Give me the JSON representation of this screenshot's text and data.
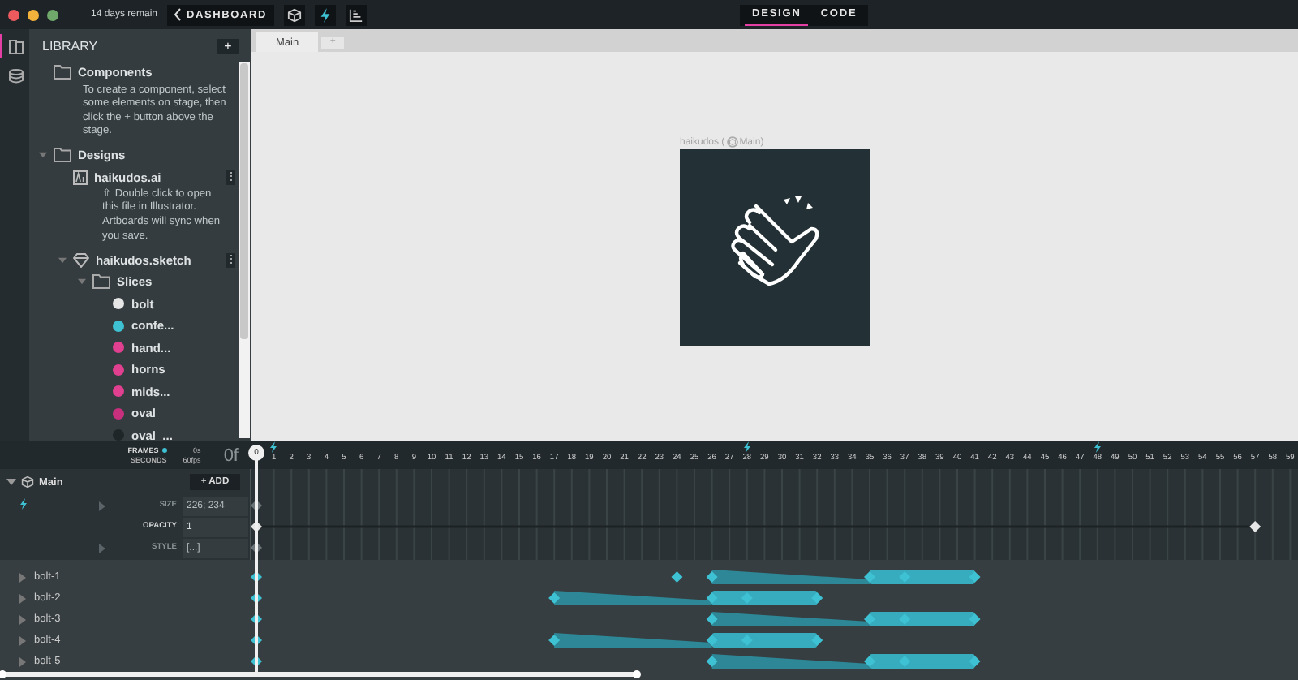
{
  "top_bar": {
    "trial": "14 days remain",
    "dashboard_button": "DASHBOARD",
    "mode_tabs": [
      {
        "label": "DESIGN",
        "selected": true
      },
      {
        "label": "CODE",
        "selected": false
      }
    ]
  },
  "side_strip": [
    {
      "kind": "library",
      "selected": true
    },
    {
      "kind": "states",
      "selected": false
    }
  ],
  "library": {
    "title": "LIBRARY",
    "add": "+",
    "tree": [
      {
        "kind": "folder",
        "name": "Components",
        "note": "To create a component, select some elements on stage, then click the + button above the stage."
      },
      {
        "kind": "folder",
        "name": "Designs",
        "expanded": true,
        "children": [
          {
            "kind": "ai",
            "name": "haikudos.ai",
            "menu": "⋮",
            "note": "⇧ Double click to open this file in Illustrator. Artboards will sync when you save."
          },
          {
            "kind": "sketch",
            "name": "haikudos.sketch",
            "menu": "⋮",
            "expanded": true,
            "children": [
              {
                "kind": "folder",
                "name": "Slices",
                "expanded": true,
                "children": [
                  {
                    "kind": "slice",
                    "name": "bolt",
                    "color": "#e6e6e6"
                  },
                  {
                    "kind": "slice",
                    "name": "confe...",
                    "color": "#3ec1d3"
                  },
                  {
                    "kind": "slice",
                    "name": "hand...",
                    "color": "#e0408f"
                  },
                  {
                    "kind": "slice",
                    "name": "horns",
                    "color": "#e0408f"
                  },
                  {
                    "kind": "slice",
                    "name": "mids...",
                    "color": "#e0408f"
                  },
                  {
                    "kind": "slice",
                    "name": "oval",
                    "color": "#c8307e"
                  },
                  {
                    "kind": "slice",
                    "name": "oval_...",
                    "color": "#1f2628"
                  }
                ]
              }
            ]
          }
        ]
      }
    ]
  },
  "stage": {
    "tabs": [
      {
        "label": "Main",
        "selected": true
      }
    ],
    "add_tab": "+",
    "artboard_name": "haikudos (",
    "artboard_component": "Main)"
  },
  "timeline": {
    "units": [
      {
        "label": "FRAMES",
        "selected": true
      },
      {
        "label": "SECONDS",
        "selected": false
      }
    ],
    "time_seconds": "0s",
    "fps": "60fps",
    "current_frame": "0f",
    "playhead": "0",
    "ruler": [
      {
        "label": "1",
        "event": true
      },
      {
        "label": "2",
        "event": false
      },
      {
        "label": "3",
        "event": false
      },
      {
        "label": "4",
        "event": false
      },
      {
        "label": "5",
        "event": false
      },
      {
        "label": "6",
        "event": false
      },
      {
        "label": "7",
        "event": false
      },
      {
        "label": "8",
        "event": false
      },
      {
        "label": "9",
        "event": false
      },
      {
        "label": "10",
        "event": false
      },
      {
        "label": "11",
        "event": false
      },
      {
        "label": "12",
        "event": false
      },
      {
        "label": "13",
        "event": false
      },
      {
        "label": "14",
        "event": false
      },
      {
        "label": "15",
        "event": false
      },
      {
        "label": "16",
        "event": false
      },
      {
        "label": "17",
        "event": false
      },
      {
        "label": "18",
        "event": false
      },
      {
        "label": "19",
        "event": false
      },
      {
        "label": "20",
        "event": false
      },
      {
        "label": "21",
        "event": false
      },
      {
        "label": "22",
        "event": false
      },
      {
        "label": "23",
        "event": false
      },
      {
        "label": "24",
        "event": false
      },
      {
        "label": "25",
        "event": false
      },
      {
        "label": "26",
        "event": false
      },
      {
        "label": "27",
        "event": false
      },
      {
        "label": "28",
        "event": true
      },
      {
        "label": "29",
        "event": false
      },
      {
        "label": "30",
        "event": false
      },
      {
        "label": "31",
        "event": false
      },
      {
        "label": "32",
        "event": false
      },
      {
        "label": "33",
        "event": false
      },
      {
        "label": "34",
        "event": false
      },
      {
        "label": "35",
        "event": false
      },
      {
        "label": "36",
        "event": false
      },
      {
        "label": "37",
        "event": false
      },
      {
        "label": "38",
        "event": false
      },
      {
        "label": "39",
        "event": false
      },
      {
        "label": "40",
        "event": false
      },
      {
        "label": "41",
        "event": false
      },
      {
        "label": "42",
        "event": false
      },
      {
        "label": "43",
        "event": false
      },
      {
        "label": "44",
        "event": false
      },
      {
        "label": "45",
        "event": false
      },
      {
        "label": "46",
        "event": false
      },
      {
        "label": "47",
        "event": false
      },
      {
        "label": "48",
        "event": true
      },
      {
        "label": "49",
        "event": false
      },
      {
        "label": "50",
        "event": false
      },
      {
        "label": "51",
        "event": false
      },
      {
        "label": "52",
        "event": false
      },
      {
        "label": "53",
        "event": false
      },
      {
        "label": "54",
        "event": false
      },
      {
        "label": "55",
        "event": false
      },
      {
        "label": "56",
        "event": false
      },
      {
        "label": "57",
        "event": false
      },
      {
        "label": "58",
        "event": false
      },
      {
        "label": "59",
        "event": false
      }
    ],
    "component": {
      "name": "Main",
      "expanded": true,
      "add_button": "+ ADD",
      "properties": [
        {
          "label": "SIZE",
          "value": "226; 234",
          "expandable": true,
          "keyframes": [
            {
              "level": 0,
              "kind": "plain"
            }
          ]
        },
        {
          "label": "OPACITY",
          "value": "1",
          "expandable": false,
          "keyframes": [
            {
              "level": 0,
              "kind": "line"
            },
            {
              "level": 0.9661,
              "kind": "plain"
            }
          ]
        },
        {
          "label": "STYLE",
          "value": "[...]",
          "expandable": true,
          "keyframes": [
            {
              "level": 0,
              "kind": "plain"
            }
          ]
        }
      ]
    },
    "layers": [
      {
        "name": "bolt-1",
        "expanded": false,
        "keyframes": [
          {
            "level": 0,
            "kind": "plain"
          },
          {
            "level": 0.4068,
            "kind": "plain"
          },
          {
            "level": 0.4407,
            "kind": "ease"
          },
          {
            "level": 0.5932,
            "kind": "solid"
          },
          {
            "level": 0.6271,
            "kind": "solid"
          },
          {
            "level": 0.6949,
            "kind": "plain"
          }
        ]
      },
      {
        "name": "bolt-2",
        "expanded": false,
        "keyframes": [
          {
            "level": 0,
            "kind": "plain"
          },
          {
            "level": 0.2881,
            "kind": "ease"
          },
          {
            "level": 0.4407,
            "kind": "solid"
          },
          {
            "level": 0.4746,
            "kind": "solid"
          },
          {
            "level": 0.5424,
            "kind": "plain"
          }
        ]
      },
      {
        "name": "bolt-3",
        "expanded": false,
        "keyframes": [
          {
            "level": 0,
            "kind": "plain"
          },
          {
            "level": 0.4407,
            "kind": "ease"
          },
          {
            "level": 0.5932,
            "kind": "solid"
          },
          {
            "level": 0.6271,
            "kind": "solid"
          },
          {
            "level": 0.6949,
            "kind": "plain"
          }
        ]
      },
      {
        "name": "bolt-4",
        "expanded": false,
        "keyframes": [
          {
            "level": 0,
            "kind": "plain"
          },
          {
            "level": 0.2881,
            "kind": "ease"
          },
          {
            "level": 0.4407,
            "kind": "solid"
          },
          {
            "level": 0.4746,
            "kind": "solid"
          },
          {
            "level": 0.5424,
            "kind": "plain"
          }
        ]
      },
      {
        "name": "bolt-5",
        "expanded": false,
        "keyframes": [
          {
            "level": 0,
            "kind": "plain"
          },
          {
            "level": 0.4407,
            "kind": "ease"
          },
          {
            "level": 0.5932,
            "kind": "solid"
          },
          {
            "level": 0.6271,
            "kind": "solid"
          },
          {
            "level": 0.6949,
            "kind": "plain"
          }
        ]
      }
    ]
  }
}
